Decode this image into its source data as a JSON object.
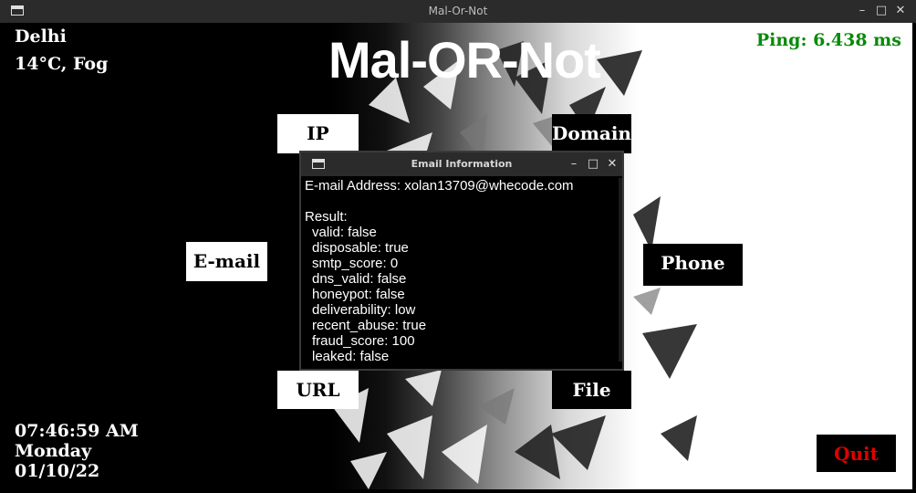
{
  "window": {
    "title": "Mal-Or-Not",
    "icon": "window-icon"
  },
  "header": {
    "title": "Mal-OR-Not"
  },
  "weather": {
    "city": "Delhi",
    "condition": "14°C, Fog"
  },
  "ping": {
    "text": "Ping: 6.438 ms",
    "color": "#0a8a0a"
  },
  "datetime": {
    "time": "07:46:59 AM",
    "day": "Monday",
    "date": "01/10/22"
  },
  "buttons": {
    "ip": "IP",
    "domain": "Domain",
    "email": "E-mail",
    "phone": "Phone No.",
    "url": "URL",
    "file": "File",
    "quit": "Quit"
  },
  "popup": {
    "title": "Email Information",
    "address_line": "E-mail Address: xolan13709@whecode.com",
    "result_label": "Result:",
    "fields": [
      "valid: false",
      "disposable: true",
      "smtp_score: 0",
      "dns_valid: false",
      "honeypot: false",
      "deliverability: low",
      "recent_abuse: true",
      "fraud_score: 100",
      "leaked: false"
    ]
  }
}
